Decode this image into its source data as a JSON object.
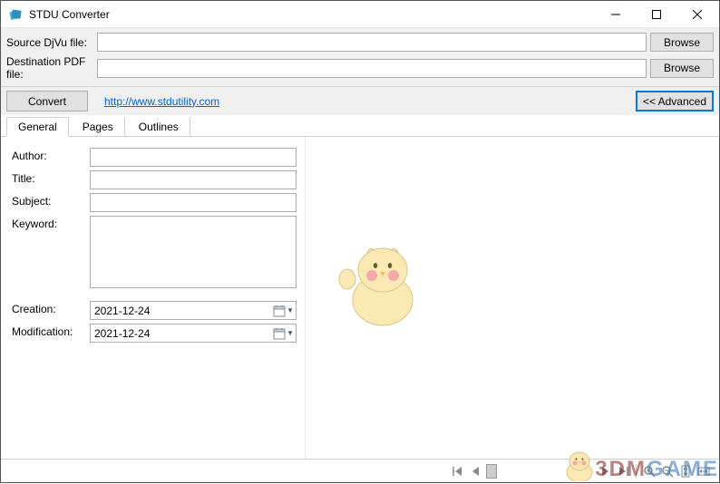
{
  "window": {
    "title": "STDU Converter"
  },
  "fileRows": {
    "sourceLabel": "Source DjVu file:",
    "sourceValue": "",
    "sourceBrowse": "Browse",
    "destLabel": "Destination PDF file:",
    "destValue": "",
    "destBrowse": "Browse"
  },
  "actions": {
    "convert": "Convert",
    "url": "http://www.stdutility.com ",
    "advanced": "<< Advanced"
  },
  "tabs": {
    "general": "General",
    "pages": "Pages",
    "outlines": "Outlines"
  },
  "form": {
    "authorLabel": "Author:",
    "authorValue": "",
    "titleLabel": "Title:",
    "titleValue": "",
    "subjectLabel": "Subject:",
    "subjectValue": "",
    "keywordLabel": "Keyword:",
    "keywordValue": "",
    "creationLabel": "Creation:",
    "creationValue": "2021-12-24",
    "modificationLabel": "Modification:",
    "modificationValue": "2021-12-24"
  },
  "watermark": {
    "part1": "3DM",
    "part2": "GAME"
  }
}
